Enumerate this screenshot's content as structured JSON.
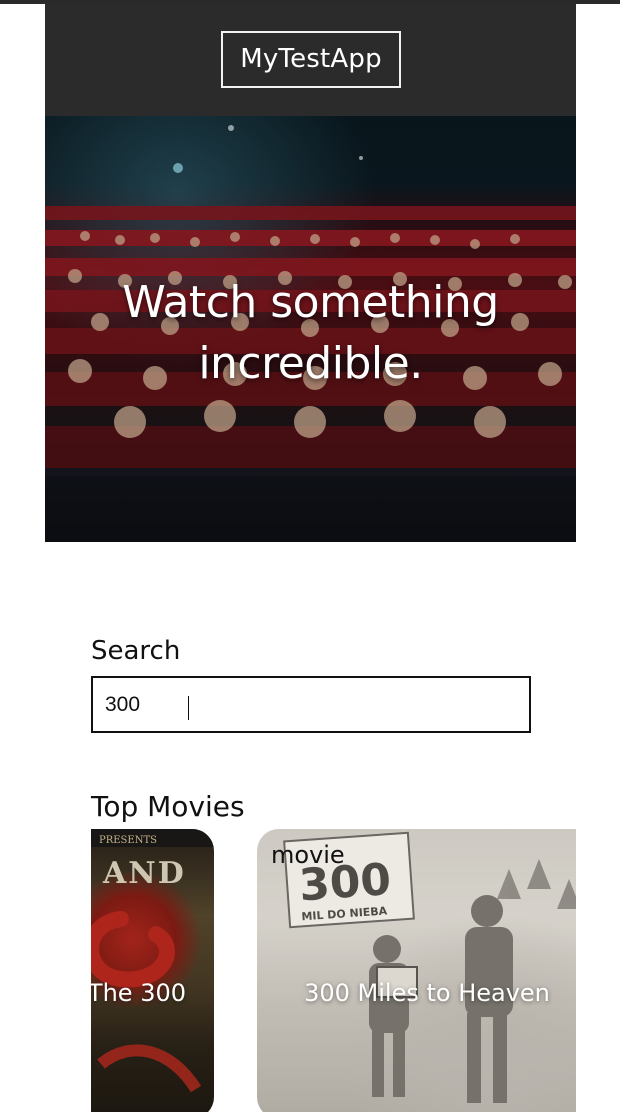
{
  "app": {
    "brand": "MyTestApp"
  },
  "hero": {
    "line1": "Watch something",
    "line2": "incredible."
  },
  "search": {
    "label": "Search",
    "value": "300"
  },
  "top_movies": {
    "title": "Top Movies",
    "items": [
      {
        "title": "The 300",
        "poster_text": [
          "PRESENTS",
          "AND"
        ]
      },
      {
        "type": "movie",
        "title": "300 Miles to Heaven",
        "poster_text": [
          "300",
          "MIL DO NIEBA"
        ]
      }
    ]
  },
  "colors": {
    "header_bg": "#2b2b2b",
    "text": "#111111",
    "white": "#ffffff"
  },
  "icons": {
    "hero": "cinema-audience-image",
    "posters": [
      "movie-poster-image",
      "movie-poster-image"
    ]
  }
}
